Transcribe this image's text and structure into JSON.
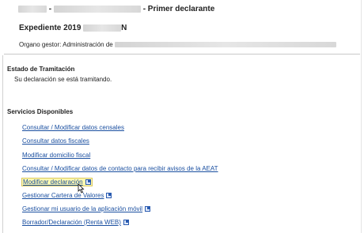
{
  "header": {
    "separator": "-",
    "role": "- Primer declarante"
  },
  "expediente": {
    "label": "Expediente 2019",
    "suffix": "N"
  },
  "organo": {
    "label": "Organo gestor: Administración de"
  },
  "estado": {
    "title": "Estado de Tramitación",
    "text": "Su declaración se está tramitando."
  },
  "servicios": {
    "title": "Servicios Disponibles",
    "items": [
      {
        "label": "Consultar / Modificar datos censales",
        "external": false
      },
      {
        "label": "Consultar datos fiscales",
        "external": false
      },
      {
        "label": "Modificar domicilio fiscal",
        "external": false
      },
      {
        "label": "Consultar / Modificar datos de contacto para recibir avisos de la AEAT",
        "external": false
      },
      {
        "label": "Modificar declaración",
        "external": true
      },
      {
        "label": "Gestionar Cartera de Valores",
        "external": true
      },
      {
        "label": "Gestionar mi usuario de la aplicación móvil",
        "external": true
      },
      {
        "label": "Borrador/Declaración (Renta WEB)",
        "external": true
      }
    ]
  },
  "colors": {
    "link": "#1a4fa0",
    "highlight": "#fff9b0"
  },
  "icons": {
    "external_link": "external-link-icon",
    "cursor": "mouse-pointer-icon"
  }
}
